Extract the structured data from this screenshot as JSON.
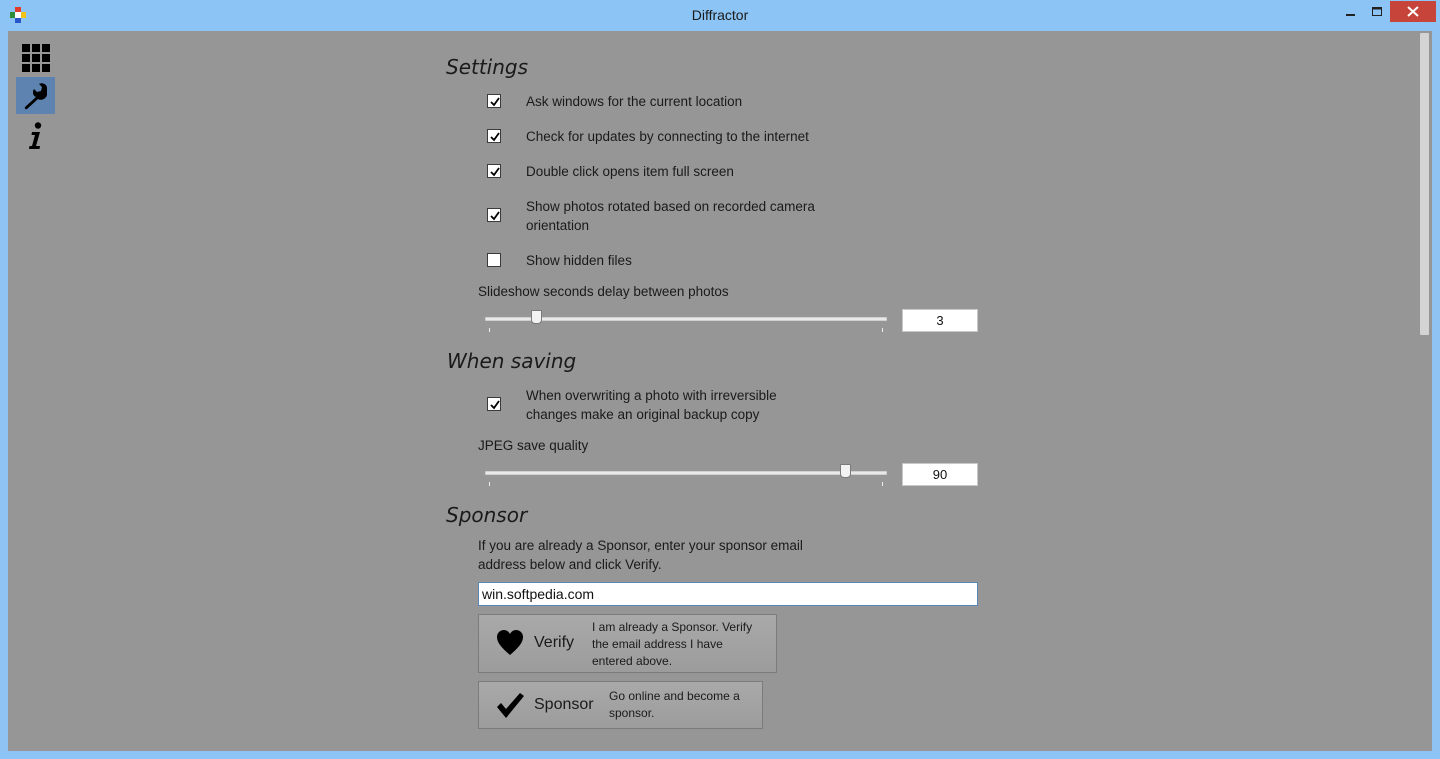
{
  "window": {
    "title": "Diffractor"
  },
  "nav": [
    {
      "name": "grid-view",
      "icon": "grid-icon",
      "active": false
    },
    {
      "name": "settings",
      "icon": "wrench-icon",
      "active": true
    },
    {
      "name": "about",
      "icon": "info-icon",
      "active": false
    }
  ],
  "settings": {
    "heading": "Settings",
    "options": [
      {
        "label": "Ask windows for the current location",
        "checked": true
      },
      {
        "label": "Check for updates by connecting to the internet",
        "checked": true
      },
      {
        "label": "Double click opens item full screen",
        "checked": true
      },
      {
        "label_line1": "Show photos rotated based on recorded camera",
        "label_line2": "orientation",
        "checked": true
      },
      {
        "label": "Show hidden files",
        "checked": false
      }
    ],
    "slideshow_label": "Slideshow seconds delay between photos",
    "slideshow_value": "3",
    "slideshow_fraction": 0.11
  },
  "saving": {
    "heading": "When saving",
    "backup_line1": "When overwriting a photo with irreversible",
    "backup_line2": "changes make an original backup copy",
    "backup_checked": true,
    "jpeg_label": "JPEG save quality",
    "jpeg_value": "90",
    "jpeg_fraction": 0.9
  },
  "sponsor": {
    "heading": "Sponsor",
    "intro_line1": "If you are already a Sponsor, enter your sponsor email",
    "intro_line2": "address below and click Verify.",
    "email_value": "win.softpedia.com",
    "verify": {
      "name": "Verify",
      "icon": "heart-icon",
      "desc_line1": "I am already a Sponsor. Verify",
      "desc_line2": "the email address I have",
      "desc_line3": "entered above."
    },
    "become": {
      "name": "Sponsor",
      "icon": "checkmark-icon",
      "desc_line1": "Go online and become a",
      "desc_line2": "sponsor."
    }
  },
  "colors": {
    "titlebar": "#8cc4f6",
    "client_bg": "#969696",
    "close_button": "#c7443b",
    "nav_active": "#5f83b0"
  }
}
